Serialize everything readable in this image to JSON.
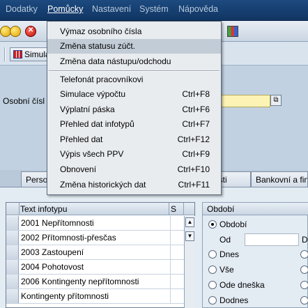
{
  "menubar": {
    "items": [
      {
        "label": "Dodatky",
        "active": false
      },
      {
        "label": "Pomůcky",
        "active": true
      },
      {
        "label": "Nastavení",
        "active": false
      },
      {
        "label": "Systém",
        "active": false
      },
      {
        "label": "Nápověda",
        "active": false
      }
    ]
  },
  "toolbar": {
    "icons": [
      "back-icon",
      "exit-icon",
      "cancel-icon",
      "layout-menu-icon"
    ]
  },
  "apptoolbar": {
    "button_label": "Simulace"
  },
  "person": {
    "label": "Osobní čísl",
    "value": ""
  },
  "tabs": [
    {
      "label": "Perso"
    },
    {
      "label": "osti"
    },
    {
      "label": "Bankovní a fin"
    }
  ],
  "infotypes": {
    "header_text": "Text infotypu",
    "header_s": "S",
    "rows": [
      {
        "text": "2001 Nepřítomnosti"
      },
      {
        "text": "2002 Přítomnosti-přesčas"
      },
      {
        "text": "2003 Zastoupení"
      },
      {
        "text": "2004 Pohotovost"
      },
      {
        "text": "2006 Kontingenty nepřítomnosti"
      },
      {
        "text": "Kontingenty přítomnosti"
      }
    ]
  },
  "period": {
    "title": "Období",
    "options": [
      {
        "label": "Období",
        "selected": true
      },
      {
        "label": "Dnes",
        "selected": false
      },
      {
        "label": "Vše",
        "selected": false
      },
      {
        "label": "Ode dneška",
        "selected": false
      },
      {
        "label": "Dodnes",
        "selected": false
      }
    ],
    "from_label": "Od",
    "to_label": "D"
  },
  "dropdown": {
    "items": [
      {
        "label": "Výmaz osobního čísla",
        "shortcut": "",
        "highlighted": false
      },
      {
        "label": "Změna statusu zúčt.",
        "shortcut": "",
        "highlighted": true
      },
      {
        "label": "Změna data nástupu/odchodu",
        "shortcut": "",
        "highlighted": false
      },
      {
        "label": "Telefonát pracovníkovi",
        "shortcut": "",
        "highlighted": false
      },
      {
        "label": "Simulace výpočtu",
        "shortcut": "Ctrl+F8",
        "highlighted": false
      },
      {
        "label": "Výplatní páska",
        "shortcut": "Ctrl+F6",
        "highlighted": false
      },
      {
        "label": "Přehled dat infotypů",
        "shortcut": "Ctrl+F7",
        "highlighted": false
      },
      {
        "label": "Přehled dat",
        "shortcut": "Ctrl+F12",
        "highlighted": false
      },
      {
        "label": "Výpis všech PPV",
        "shortcut": "Ctrl+F9",
        "highlighted": false
      },
      {
        "label": "Obnovení",
        "shortcut": "Ctrl+F10",
        "highlighted": false
      },
      {
        "label": "Změna historických dat",
        "shortcut": "Ctrl+F11",
        "highlighted": false
      }
    ]
  }
}
